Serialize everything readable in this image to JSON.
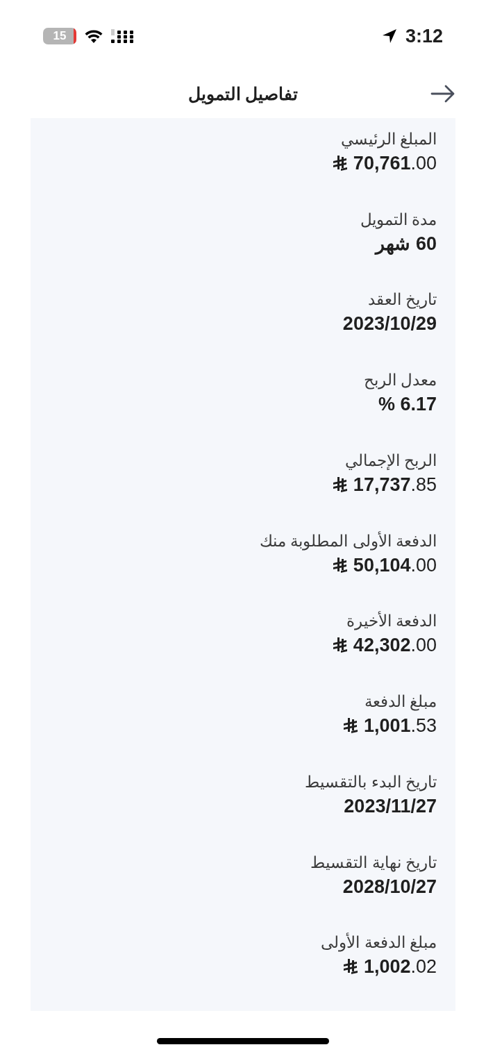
{
  "status_bar": {
    "battery": "15",
    "time": "3:12"
  },
  "header": {
    "title": "تفاصيل التمويل"
  },
  "details": [
    {
      "label": "المبلغ الرئيسي",
      "value": "**70,761**.00",
      "kind": "money"
    },
    {
      "label": "مدة التمويل",
      "value": "60 شهر",
      "kind": "text"
    },
    {
      "label": "تاريخ العقد",
      "value": "2023/10/29",
      "kind": "text"
    },
    {
      "label": "معدل الربح",
      "value": "6.17 %",
      "kind": "text"
    },
    {
      "label": "الربح الإجمالي",
      "value": "**17,737**.85",
      "kind": "money"
    },
    {
      "label": "الدفعة الأولى المطلوبة منك",
      "value": "**50,104**.00",
      "kind": "money"
    },
    {
      "label": "الدفعة الأخيرة",
      "value": "**42,302**.00",
      "kind": "money"
    },
    {
      "label": "مبلغ الدفعة",
      "value": "**1,001**.53",
      "kind": "money"
    },
    {
      "label": "تاريخ البدء بالتقسيط",
      "value": "2023/11/27",
      "kind": "text"
    },
    {
      "label": "تاريخ نهاية التقسيط",
      "value": "2028/10/27",
      "kind": "text"
    },
    {
      "label": "مبلغ الدفعة الأولى",
      "value": "**1,002**.02",
      "kind": "money"
    }
  ]
}
